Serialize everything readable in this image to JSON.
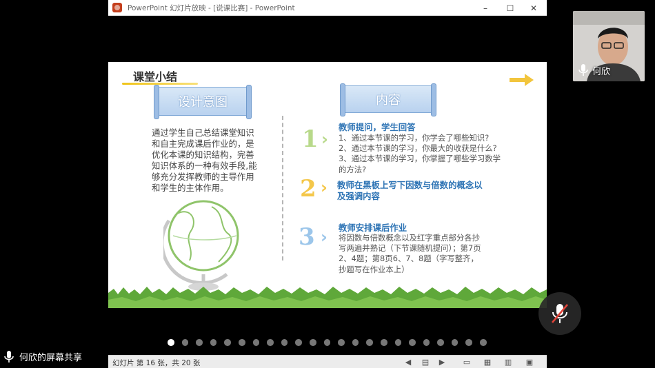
{
  "window": {
    "title": "PowerPoint 幻灯片放映 - [说课比赛] - PowerPoint",
    "controls": {
      "minimize": "–",
      "maximize": "☐",
      "close": "✕"
    }
  },
  "slide": {
    "title": "课堂小结",
    "left_banner": "设计意图",
    "right_banner": "内容",
    "design_text": "通过学生自己总结课堂知识和自主完成课后作业的，是优化本课的知识结构，完善知识体系的一种有效手段,能够充分发挥教师的主导作用和学生的主体作用。",
    "sections": [
      {
        "num": "1",
        "title": "教师提问，学生回答",
        "body": [
          "1、通过本节课的学习，你学会了哪些知识?",
          "2、通过本节课的学习，你最大的收获是什么?",
          "3、通过本节课的学习，你掌握了哪些学习数学的方法?"
        ]
      },
      {
        "num": "2",
        "title": "教师在黑板上写下因数与倍数的概念以及强调内容",
        "body": []
      },
      {
        "num": "3",
        "title": "教师安排课后作业",
        "body": [
          "将因数与倍数概念以及红字重点部分各抄写两遍并熟记（下节课随机提问）；第7页2、4题；第8页6、7、8题（字写整齐，抄题写在作业本上）"
        ]
      }
    ],
    "colors": {
      "num1": "#b8d98a",
      "num2": "#f4c74a",
      "num3": "#9cc6ea",
      "grass": "#5fa83a",
      "banner": "#c4dbf4"
    }
  },
  "nav": {
    "dot_count": 23,
    "active_index": 0
  },
  "statusbar": {
    "slide_info": "幻灯片 第 16 张，共 20 张",
    "icons": [
      "prev-icon",
      "menu-icon",
      "next-icon",
      "normal-view-icon",
      "sorter-view-icon",
      "reading-view-icon",
      "slideshow-icon"
    ]
  },
  "webcam": {
    "name": "何欣"
  },
  "share": {
    "label": "何欣的屏幕共享"
  }
}
